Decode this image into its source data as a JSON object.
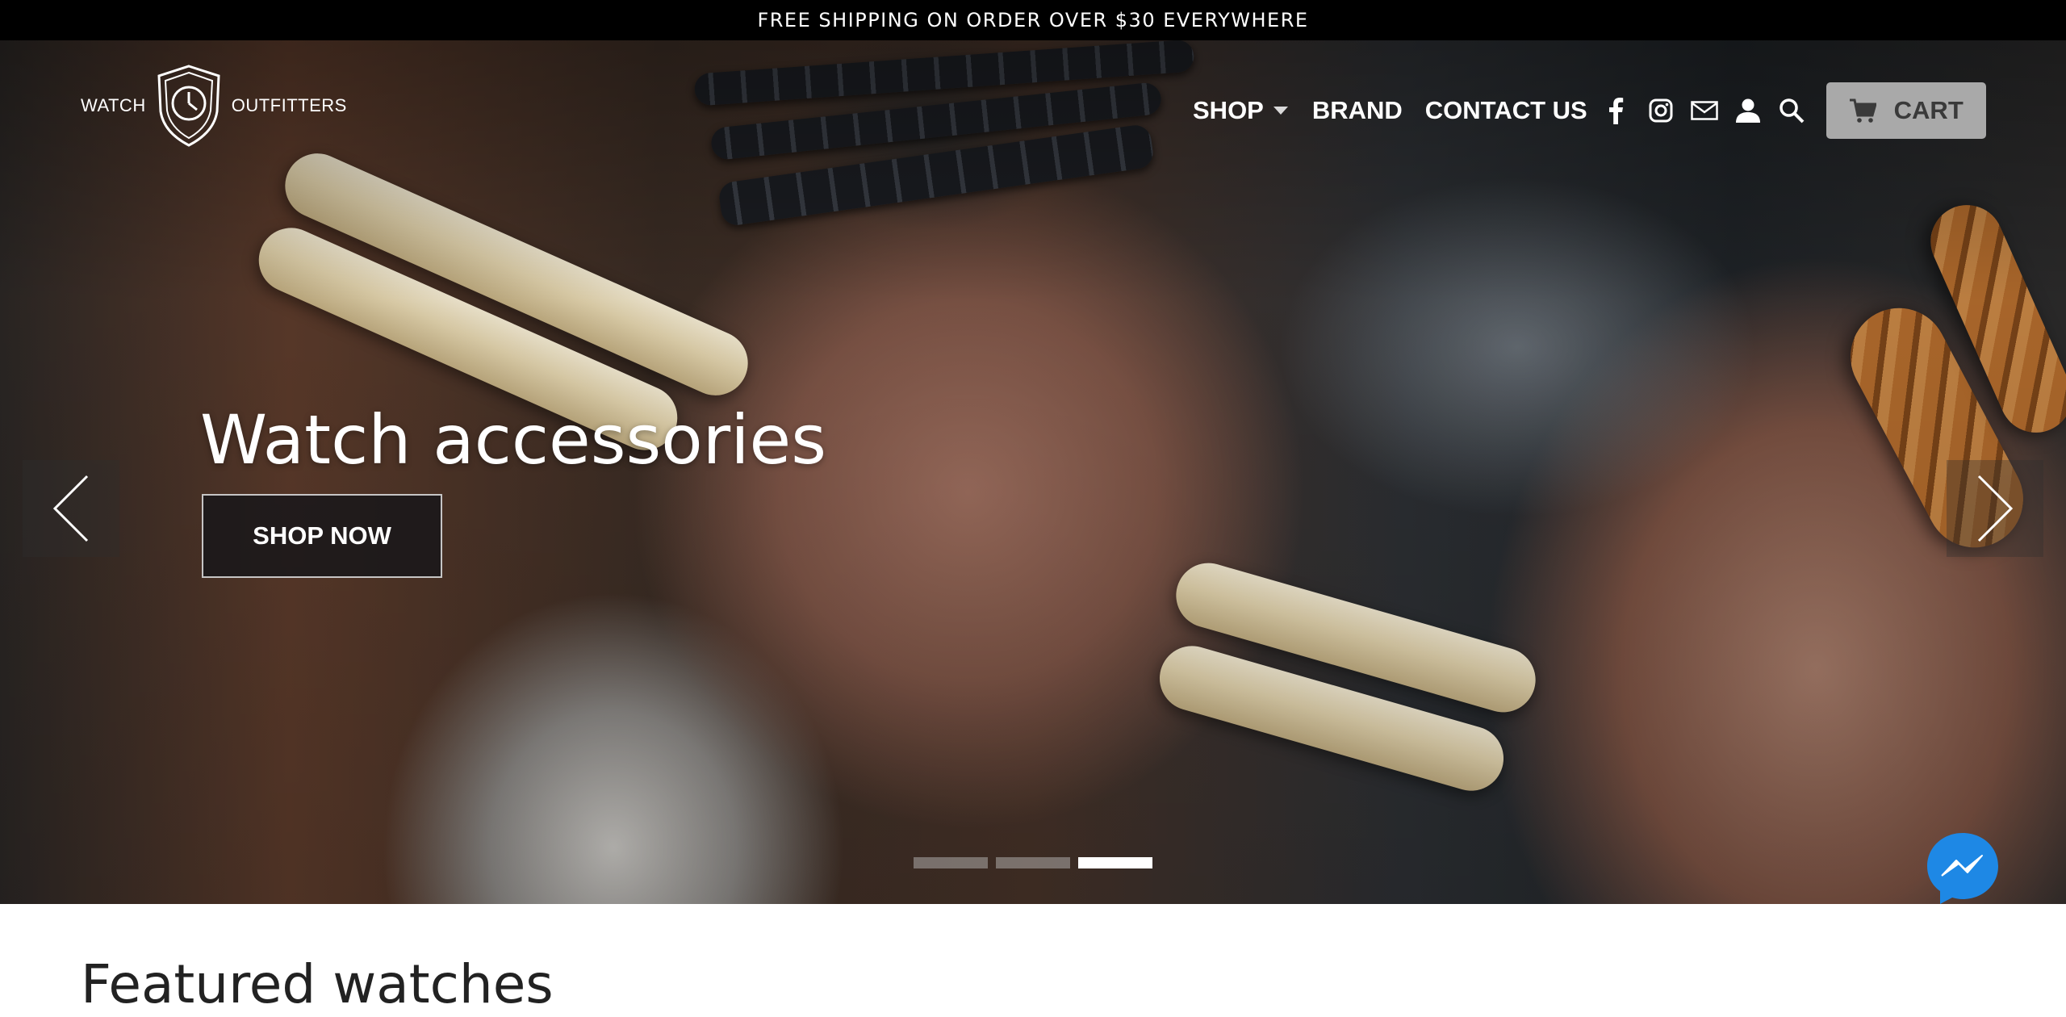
{
  "announcement": {
    "text": "FREE SHIPPING ON ORDER OVER $30 EVERYWHERE"
  },
  "brand": {
    "logo_left": "WATCH",
    "logo_right": "OUTFITTERS",
    "logo_icon": "clock-shield-icon"
  },
  "nav": {
    "items": [
      {
        "label": "SHOP",
        "has_dropdown": true
      },
      {
        "label": "BRAND"
      },
      {
        "label": "CONTACT US"
      }
    ],
    "icons": [
      "facebook-icon",
      "instagram-icon",
      "mail-icon",
      "account-icon",
      "search-icon"
    ],
    "cart_label": "CART",
    "cart_icon": "cart-icon"
  },
  "hero": {
    "slide_title": "Watch accessories",
    "cta_label": "SHOP NOW",
    "slide_count": 3,
    "active_slide": 3,
    "prev_icon": "chevron-left-icon",
    "next_icon": "chevron-right-icon"
  },
  "featured": {
    "title": "Featured watches"
  },
  "chat": {
    "icon": "messenger-icon"
  },
  "colors": {
    "announcement_bg": "#000000",
    "cart_bg": "#a9a9a9",
    "messenger_blue": "#1e88e5"
  }
}
